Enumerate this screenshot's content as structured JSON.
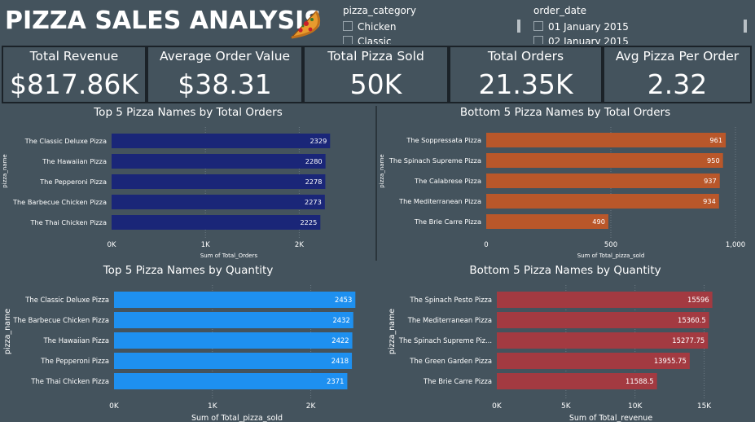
{
  "header": {
    "title": "PIZZA SALES ANALYSIS",
    "icon": "pizza-slice-icon"
  },
  "slicers": [
    {
      "title": "pizza_category",
      "items": [
        "Chicken",
        "Classic"
      ]
    },
    {
      "title": "order_date",
      "items": [
        "01 January 2015",
        "02 January 2015"
      ]
    }
  ],
  "kpis": [
    {
      "label": "Total Revenue",
      "value": "$817.86K"
    },
    {
      "label": "Average Order Value",
      "value": "$38.31"
    },
    {
      "label": "Total Pizza Sold",
      "value": "50K"
    },
    {
      "label": "Total Orders",
      "value": "21.35K"
    },
    {
      "label": "Avg Pizza Per Order",
      "value": "2.32"
    }
  ],
  "colors": {
    "background": "#44535d",
    "navy": "#1a2678",
    "orange": "#b9572a",
    "blue": "#1e90f0",
    "red": "#a33a41"
  },
  "chart_data": [
    {
      "type": "bar",
      "orientation": "horizontal",
      "title": "Top 5 Pizza Names by Total Orders",
      "xlabel": "Sum of Total_Orders",
      "ylabel": "pizza_name",
      "categories": [
        "The Classic Deluxe Pizza",
        "The Hawaiian Pizza",
        "The Pepperoni Pizza",
        "The Barbecue Chicken Pizza",
        "The Thai Chicken Pizza"
      ],
      "values": [
        2329,
        2280,
        2278,
        2273,
        2225
      ],
      "data_labels": [
        "2329",
        "2280",
        "2278",
        "2273",
        "2225"
      ],
      "xlim": [
        0,
        2500
      ],
      "xticks": [
        0,
        1000,
        2000
      ],
      "xtick_labels": [
        "0K",
        "1K",
        "2K"
      ],
      "color": "#1a2678",
      "grid": true
    },
    {
      "type": "bar",
      "orientation": "horizontal",
      "title": "Bottom 5 Pizza Names by Total Orders",
      "xlabel": "Sum of Total_pizza_sold",
      "ylabel": "pizza_name",
      "categories": [
        "The Soppressata Pizza",
        "The Spinach Supreme Pizza",
        "The Calabrese Pizza",
        "The Mediterranean Pizza",
        "The Brie Carre Pizza"
      ],
      "values": [
        961,
        950,
        937,
        934,
        490
      ],
      "data_labels": [
        "961",
        "950",
        "937",
        "934",
        "490"
      ],
      "xlim": [
        0,
        1000
      ],
      "xticks": [
        0,
        500,
        1000
      ],
      "xtick_labels": [
        "0",
        "500",
        "1,000"
      ],
      "color": "#b9572a",
      "grid": true
    },
    {
      "type": "bar",
      "orientation": "horizontal",
      "title": "Top 5 Pizza Names by Quantity",
      "xlabel": "Sum of Total_pizza_sold",
      "ylabel": "pizza_name",
      "categories": [
        "The Classic Deluxe Pizza",
        "The Barbecue Chicken Pizza",
        "The Hawaiian Pizza",
        "The Pepperoni Pizza",
        "The Thai Chicken Pizza"
      ],
      "values": [
        2453,
        2432,
        2422,
        2418,
        2371
      ],
      "data_labels": [
        "2453",
        "2432",
        "2422",
        "2418",
        "2371"
      ],
      "xlim": [
        0,
        2500
      ],
      "xticks": [
        0,
        1000,
        2000
      ],
      "xtick_labels": [
        "0K",
        "1K",
        "2K"
      ],
      "color": "#1e90f0",
      "grid": true
    },
    {
      "type": "bar",
      "orientation": "horizontal",
      "title": "Bottom 5 Pizza Names by Quantity",
      "xlabel": "Sum of Total_revenue",
      "ylabel": "pizza_name",
      "categories": [
        "The Spinach Pesto Pizza",
        "The Mediterranean Pizza",
        "The Spinach Supreme Piz...",
        "The Green Garden Pizza",
        "The Brie Carre Pizza"
      ],
      "values": [
        15596,
        15360.5,
        15277.75,
        13955.75,
        11588.5
      ],
      "data_labels": [
        "15596",
        "15360.5",
        "15277.75",
        "13955.75",
        "11588.5"
      ],
      "xlim": [
        0,
        16500
      ],
      "xticks": [
        0,
        5000,
        10000,
        15000
      ],
      "xtick_labels": [
        "0K",
        "5K",
        "10K",
        "15K"
      ],
      "color": "#a33a41",
      "grid": true
    }
  ]
}
